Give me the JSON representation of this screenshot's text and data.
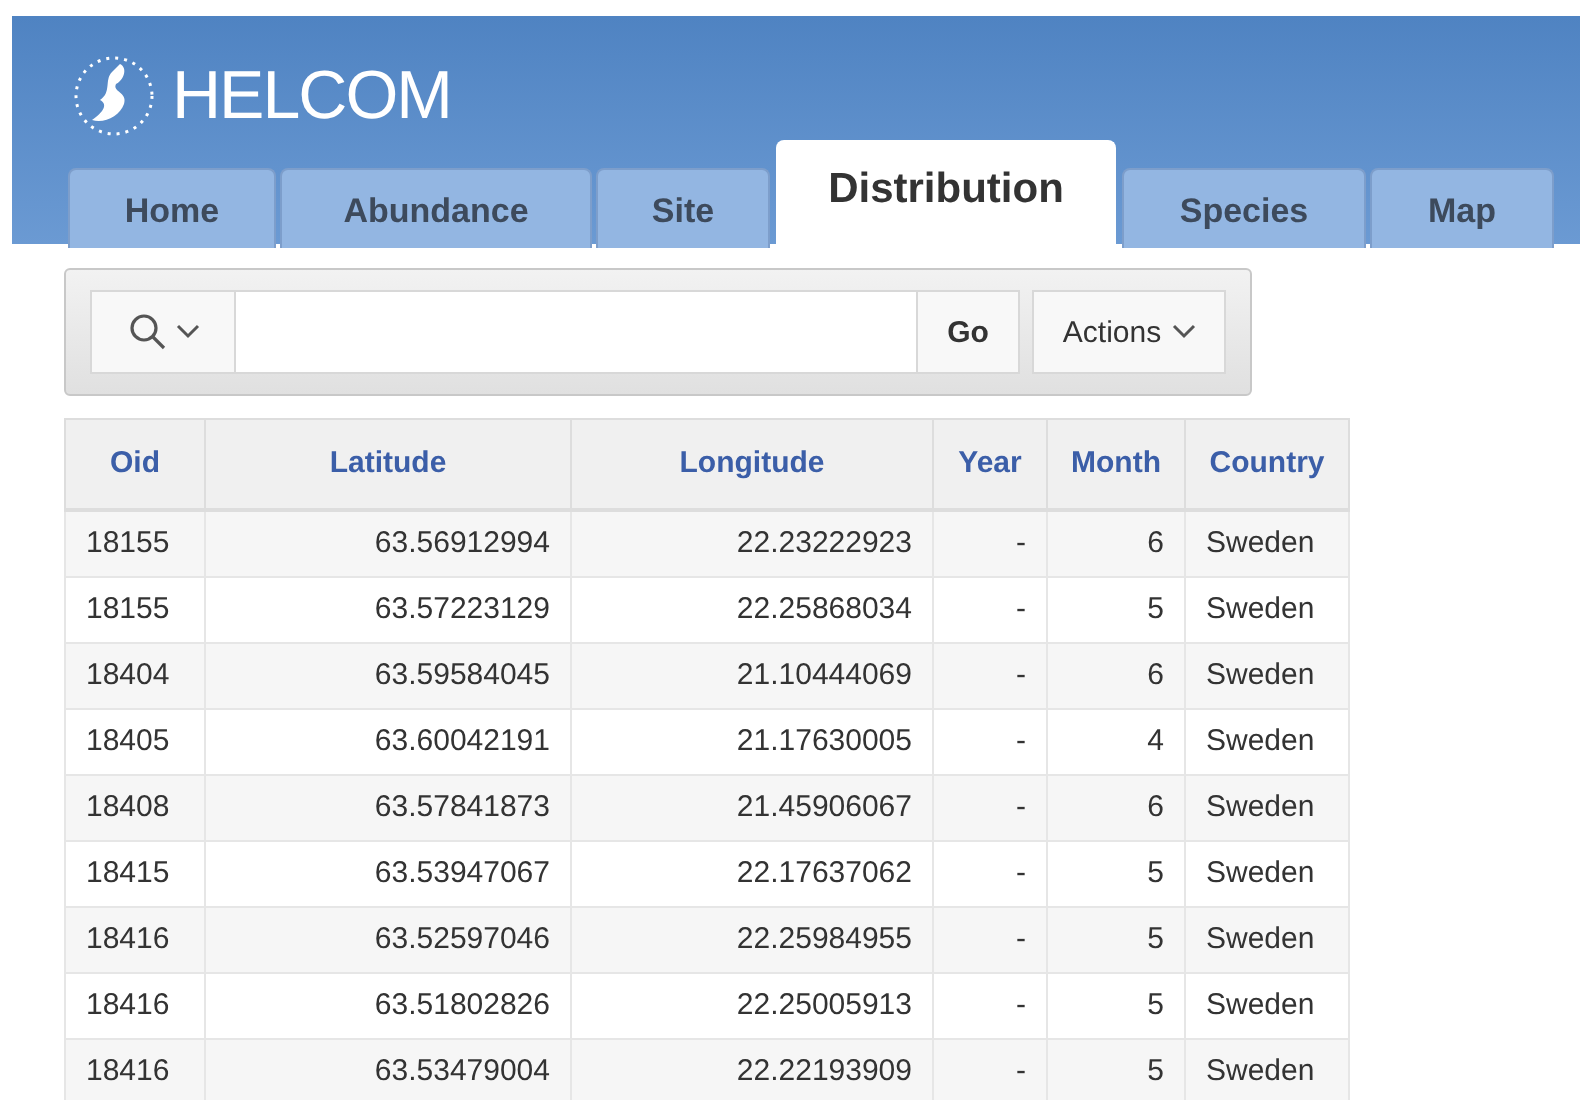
{
  "header": {
    "logo_text": "HELCOM"
  },
  "tabs": [
    {
      "label": "Home",
      "selected": false
    },
    {
      "label": "Abundance",
      "selected": false
    },
    {
      "label": "Site",
      "selected": false
    },
    {
      "label": "Distribution",
      "selected": true
    },
    {
      "label": "Species",
      "selected": false
    },
    {
      "label": "Map",
      "selected": false
    }
  ],
  "toolbar": {
    "go_button": "Go",
    "actions_button": "Actions"
  },
  "table": {
    "columns": [
      "Oid",
      "Latitude",
      "Longitude",
      "Year",
      "Month",
      "Country"
    ],
    "rows": [
      [
        "18155",
        "63.56912994",
        "22.23222923",
        "-",
        "6",
        "Sweden"
      ],
      [
        "18155",
        "63.57223129",
        "22.25868034",
        "-",
        "5",
        "Sweden"
      ],
      [
        "18404",
        "63.59584045",
        "21.10444069",
        "-",
        "6",
        "Sweden"
      ],
      [
        "18405",
        "63.60042191",
        "21.17630005",
        "-",
        "4",
        "Sweden"
      ],
      [
        "18408",
        "63.57841873",
        "21.45906067",
        "-",
        "6",
        "Sweden"
      ],
      [
        "18415",
        "63.53947067",
        "22.17637062",
        "-",
        "5",
        "Sweden"
      ],
      [
        "18416",
        "63.52597046",
        "22.25984955",
        "-",
        "5",
        "Sweden"
      ],
      [
        "18416",
        "63.51802826",
        "22.25005913",
        "-",
        "5",
        "Sweden"
      ],
      [
        "18416",
        "63.53479004",
        "22.22193909",
        "-",
        "5",
        "Sweden"
      ]
    ]
  }
}
